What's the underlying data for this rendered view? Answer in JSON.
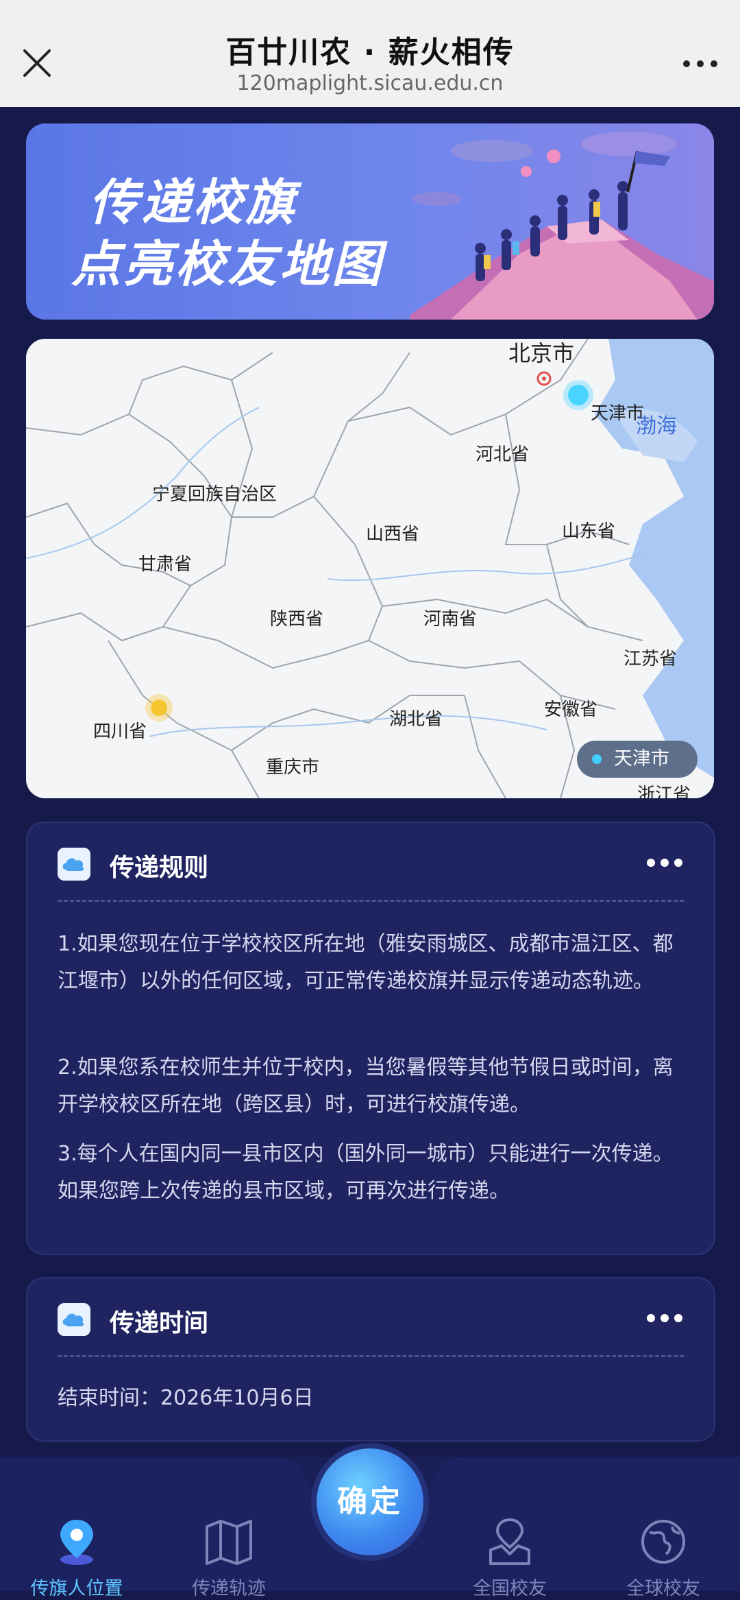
{
  "header": {
    "title": "百廿川农 · 薪火相传",
    "url": "120maplight.sicau.edu.cn"
  },
  "banner": {
    "line1": "传递校旗",
    "line2": "点亮校友地图"
  },
  "map": {
    "labels": {
      "beijing": "北京市",
      "tianjin": "天津市",
      "bohai": "渤海",
      "hebei": "河北省",
      "ningxia": "宁夏回族自治区",
      "shanxi": "山西省",
      "shandong": "山东省",
      "gansu": "甘肃省",
      "shaanxi": "陕西省",
      "henan": "河南省",
      "jiangsu": "江苏省",
      "sichuan": "四川省",
      "hubei": "湖北省",
      "anhui": "安徽省",
      "chongqing": "重庆市",
      "zhejiang": "浙江省"
    },
    "current_location": "天津市",
    "colors": {
      "marker_current": "#48d4ff",
      "marker_origin": "#f6c631",
      "water": "#a9c8f3"
    }
  },
  "rules": {
    "title": "传递规则",
    "items": [
      "1.如果您现在位于学校校区所在地（雅安雨城区、成都市温江区、都江堰市）以外的任何区域，可正常传递校旗并显示传递动态轨迹。",
      "2.如果您系在校师生并位于校内，当您暑假等其他节假日或时间，离开学校校区所在地（跨区县）时，可进行校旗传递。",
      "3.每个人在国内同一县市区内（国外同一城市）只能进行一次传递。如果您跨上次传递的县市区域，可再次进行传递。"
    ]
  },
  "time": {
    "title": "传递时间",
    "end_text": "结束时间：2026年10月6日"
  },
  "nav": {
    "items": [
      {
        "label": "传旗人位置",
        "icon": "location-pin-icon",
        "active": true
      },
      {
        "label": "传递轨迹",
        "icon": "map-icon",
        "active": false
      },
      {
        "label": "全国校友",
        "icon": "map-pin-icon",
        "active": false
      },
      {
        "label": "全球校友",
        "icon": "globe-icon",
        "active": false
      }
    ],
    "confirm_label": "确定",
    "colors": {
      "active": "#5fc5ff",
      "inactive": "#7d84b8"
    }
  }
}
